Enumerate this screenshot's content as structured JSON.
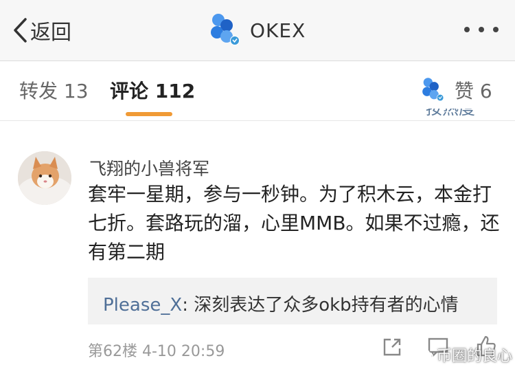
{
  "nav": {
    "back_label": "返回",
    "title": "OKEX"
  },
  "tabs": {
    "repost": "转发 13",
    "comments": "评论 112",
    "likes": "赞 6"
  },
  "sort": {
    "label": "按热度"
  },
  "comment": {
    "username": "飞翔的小兽将军",
    "body": "套牢一星期，参与一秒钟。为了积木云，本金打七折。套路玩的溜，心里MMB。如果不过瘾，还有第二期",
    "reply": {
      "user": "Please_X",
      "text": ": 深刻表达了众多okb持有者的心情"
    },
    "floor": "第62楼",
    "time": "4-10 20:59"
  },
  "watermark": "币圈的良心",
  "colors": {
    "accent": "#f09a35",
    "link": "#4f6f97",
    "brand_blue": "#2d7de0",
    "verified": "#3a9ad9"
  },
  "icons": {
    "back": "chevron-left-icon",
    "more": "more-dots-icon",
    "share": "share-icon",
    "comment": "comment-icon",
    "like": "thumbs-up-icon"
  }
}
